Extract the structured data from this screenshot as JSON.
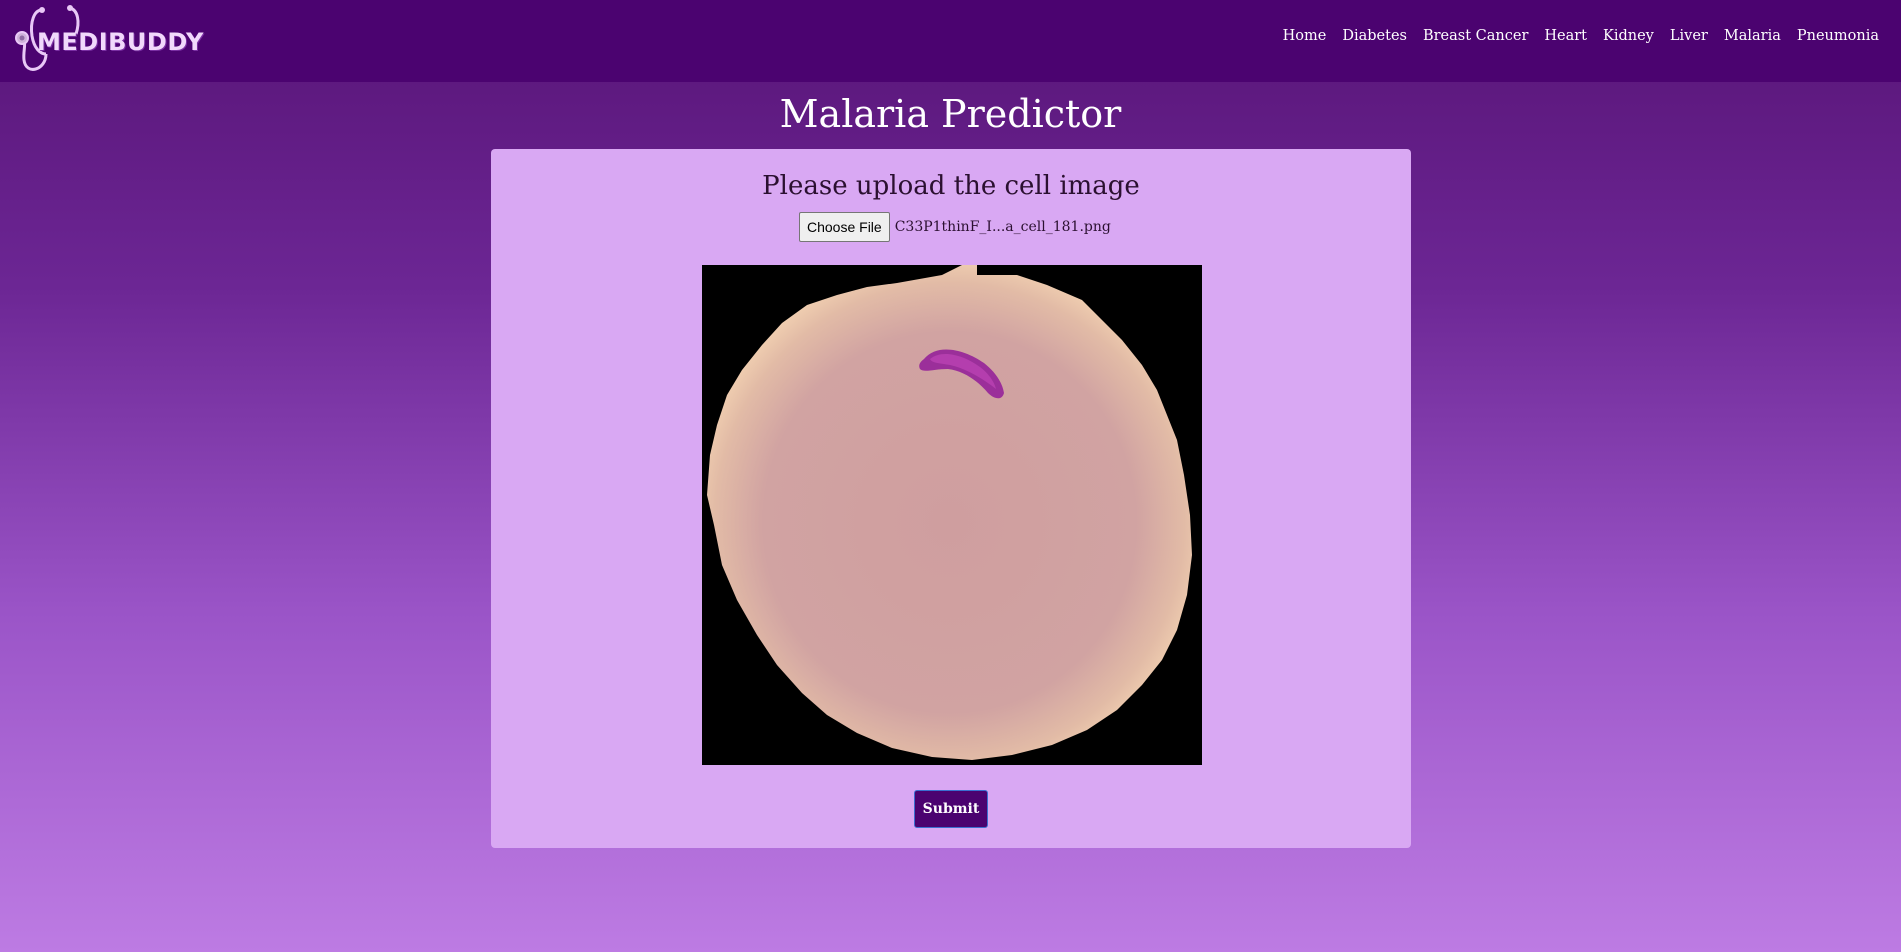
{
  "brand": {
    "name": "MEDIBUDDY",
    "logo_icon": "stethoscope-icon"
  },
  "nav": {
    "items": [
      "Home",
      "Diabetes",
      "Breast Cancer",
      "Heart",
      "Kidney",
      "Liver",
      "Malaria",
      "Pneumonia"
    ]
  },
  "page": {
    "title": "Malaria Predictor"
  },
  "form": {
    "heading": "Please upload the cell image",
    "choose_file_label": "Choose File",
    "file_name": "C33P1thinF_I...a_cell_181.png",
    "submit_label": "Submit"
  },
  "colors": {
    "navbar": "#4b0370",
    "card": "#d9a8f3",
    "button": "#4b0370",
    "gradient_top": "#581477",
    "gradient_bottom": "#bd7be3"
  }
}
